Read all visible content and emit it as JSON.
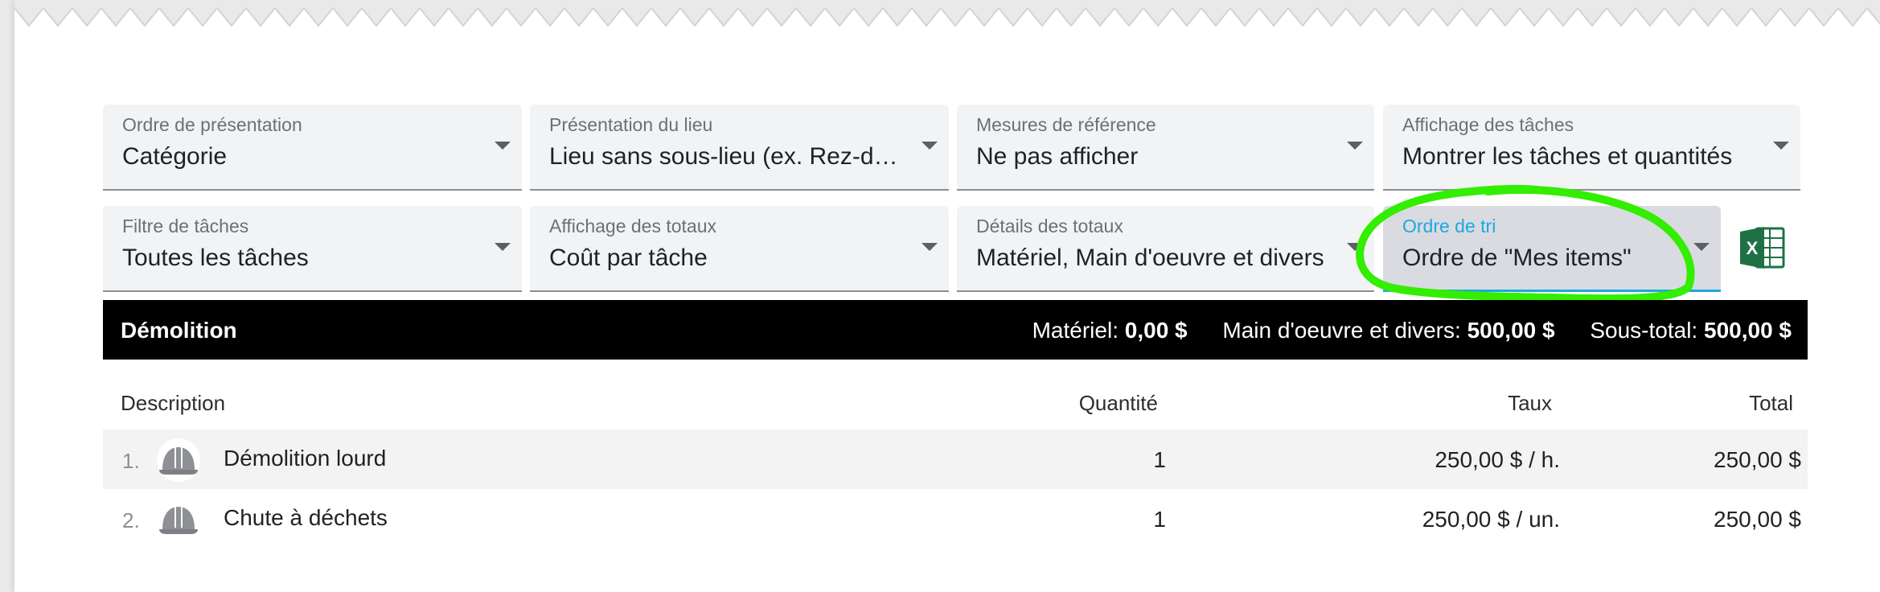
{
  "filters_row1": [
    {
      "label": "Ordre de présentation",
      "value": "Catégorie"
    },
    {
      "label": "Présentation du lieu",
      "value": "Lieu sans sous-lieu (ex. Rez-de-chaussée)"
    },
    {
      "label": "Mesures de référence",
      "value": "Ne pas afficher"
    },
    {
      "label": "Affichage des tâches",
      "value": "Montrer les tâches et quantités"
    }
  ],
  "filters_row2": [
    {
      "label": "Filtre de tâches",
      "value": "Toutes les tâches"
    },
    {
      "label": "Affichage des totaux",
      "value": "Coût par tâche"
    },
    {
      "label": "Détails des totaux",
      "value": "Matériel, Main d'oeuvre et divers"
    },
    {
      "label": "Ordre de tri",
      "value": "Ordre de \"Mes items\""
    }
  ],
  "excel_icon": "excel-export-icon",
  "section": {
    "title": "Démolition",
    "material_label": "Matériel:",
    "material_value": "0,00 $",
    "labor_label": "Main d'oeuvre et divers:",
    "labor_value": "500,00 $",
    "subtotal_label": "Sous-total:",
    "subtotal_value": "500,00 $"
  },
  "table": {
    "headers": {
      "description": "Description",
      "quantity": "Quantité",
      "rate": "Taux",
      "total": "Total"
    },
    "rows": [
      {
        "index": "1.",
        "icon": "hard-hat-icon",
        "description": "Démolition lourd",
        "quantity": "1",
        "rate": "250,00 $ / h.",
        "total": "250,00 $"
      },
      {
        "index": "2.",
        "icon": "hard-hat-icon",
        "description": "Chute à déchets",
        "quantity": "1",
        "rate": "250,00 $ / un.",
        "total": "250,00 $"
      }
    ]
  },
  "colors": {
    "active_accent": "#1ea7e1",
    "highlight": "#33ee00",
    "excel_green": "#1e7145"
  }
}
